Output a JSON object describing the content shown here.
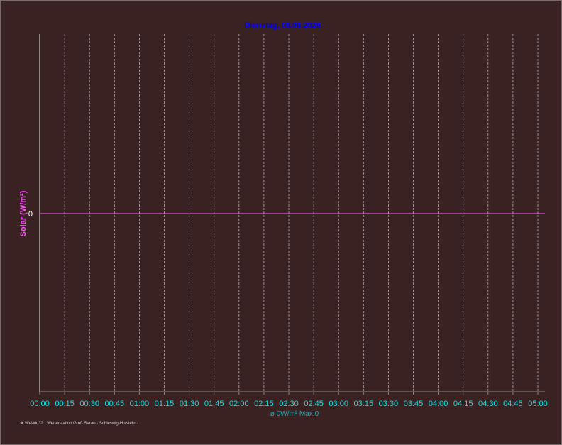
{
  "chart_data": {
    "type": "line",
    "title": "Dienstag, 08.06.2026",
    "ylabel": "Solar (W/m²)",
    "xlabel": "",
    "x_ticks": [
      "00:00",
      "00:15",
      "00:30",
      "00:45",
      "01:00",
      "01:15",
      "01:30",
      "01:45",
      "02:00",
      "02:15",
      "02:30",
      "02:45",
      "03:00",
      "03:15",
      "03:30",
      "03:45",
      "04:00",
      "04:15",
      "04:30",
      "04:45",
      "05:00"
    ],
    "y_ticks": [
      "0"
    ],
    "series": [
      {
        "x": [
          "00:00",
          "05:00"
        ],
        "values": [
          0,
          0
        ],
        "color": "#ff66ff"
      }
    ],
    "grid": true,
    "stats": "ø 0W/m²  Max:0"
  },
  "footer": "❖ WeWin32  ·  Wetterstation Groß Sarau · Schleswig-Holstein  ·",
  "colors": {
    "background": "#3a2222",
    "title": "#0000ff",
    "axis_tick": "#00e5e5",
    "ylabel": "#ff55ff",
    "series": "#ff66ff",
    "grid": "#b4aaaa",
    "axis": "#8a8a7a"
  }
}
